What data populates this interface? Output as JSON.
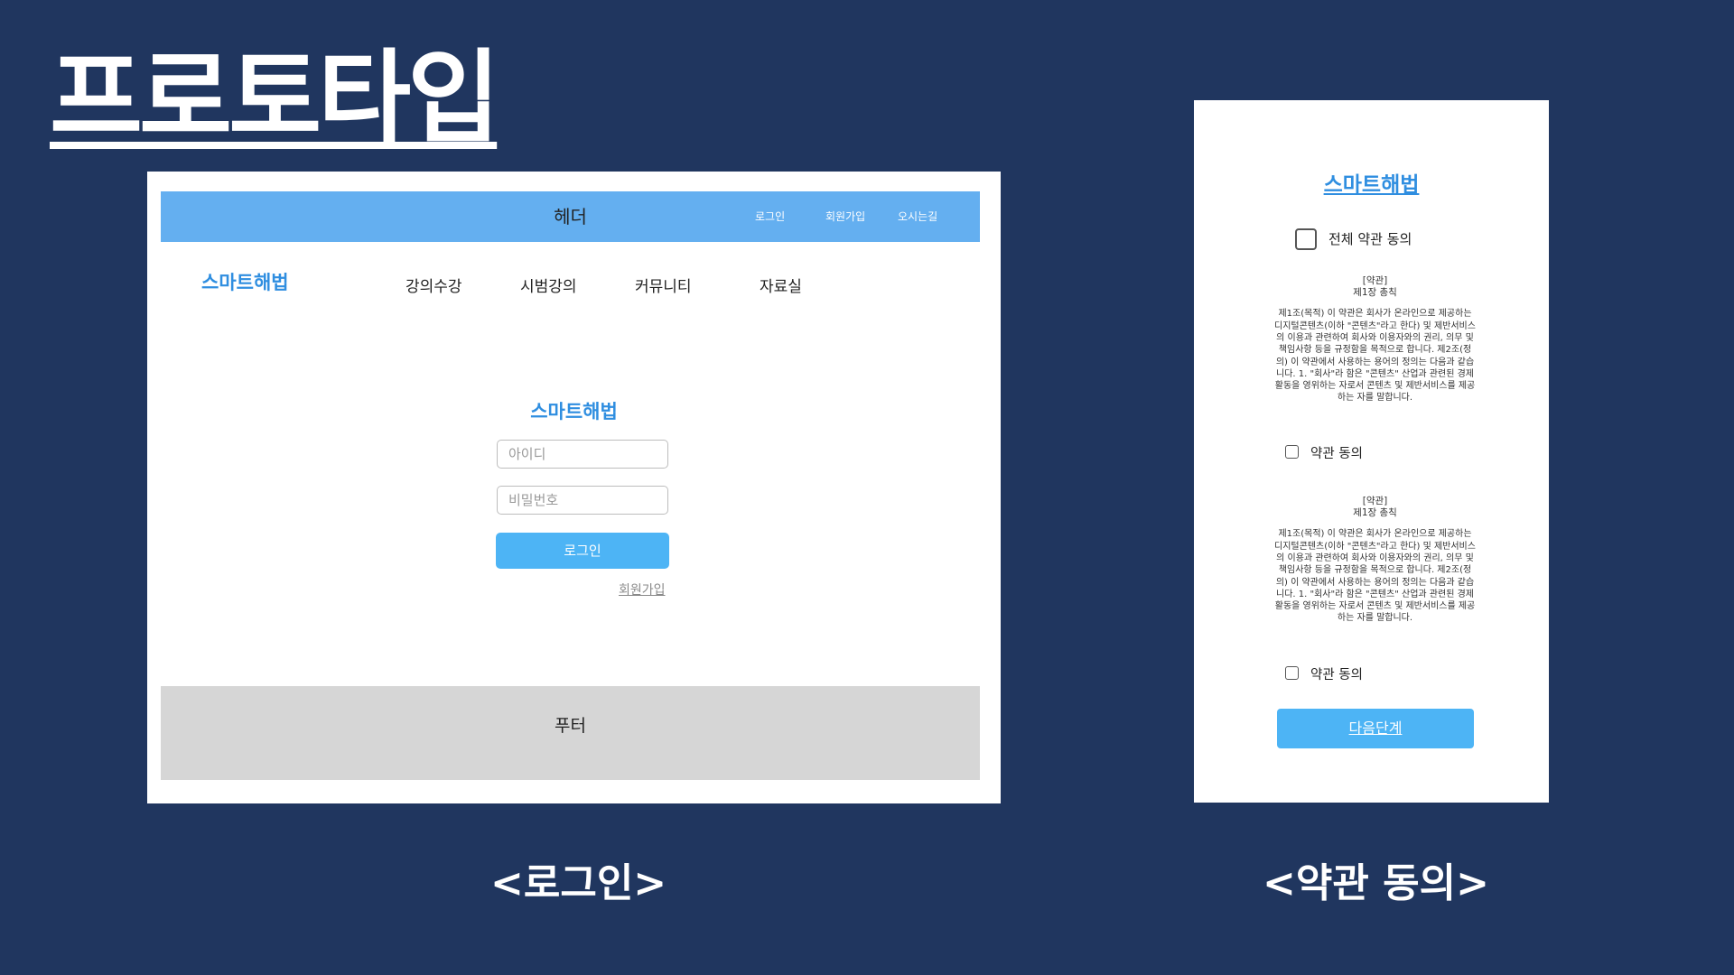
{
  "slide": {
    "title": "프로토타입",
    "captions": {
      "login": "<로그인>",
      "terms": "<약관 동의>"
    }
  },
  "login_page": {
    "header": {
      "title": "헤더",
      "links": [
        "로그인",
        "회원가입",
        "오시는길"
      ]
    },
    "logo": "스마트해법",
    "nav": [
      "강의수강",
      "시범강의",
      "커뮤니티",
      "자료실"
    ],
    "form": {
      "logo": "스마트해법",
      "id_placeholder": "아이디",
      "password_placeholder": "비밀번호",
      "login_button": "로그인",
      "signup_link": "회원가입"
    },
    "footer": "푸터"
  },
  "terms_page": {
    "logo": "스마트해법",
    "agree_all_label": "전체 약관 동의",
    "terms": [
      {
        "heading": "[약관]",
        "chapter": "제1장 총칙",
        "body": "제1조(목적) 이 약관은 회사가 온라인으로 제공하는 디지털콘텐츠(이하 \"콘텐츠\"라고 한다) 및 제반서비스의 이용과 관련하여 회사와 이용자와의 권리, 의무 및 책임사항 등을 규정함을 목적으로 합니다. 제2조(정의) 이 약관에서 사용하는 용어의 정의는 다음과 같습니다. 1. \"회사\"라 함은 \"콘텐츠\" 산업과 관련된 경제활동을 영위하는 자로서 콘텐츠 및 제반서비스를 제공하는 자를 말합니다.",
        "agree_label": "약관 동의"
      },
      {
        "heading": "[약관]",
        "chapter": "제1장 총칙",
        "body": "제1조(목적) 이 약관은 회사가 온라인으로 제공하는 디지털콘텐츠(이하 \"콘텐츠\"라고 한다) 및 제반서비스의 이용과 관련하여 회사와 이용자와의 권리, 의무 및 책임사항 등을 규정함을 목적으로 합니다. 제2조(정의) 이 약관에서 사용하는 용어의 정의는 다음과 같습니다. 1. \"회사\"라 함은 \"콘텐츠\" 산업과 관련된 경제활동을 영위하는 자로서 콘텐츠 및 제반서비스를 제공하는 자를 말합니다.",
        "agree_label": "약관 동의"
      }
    ],
    "next_button": "다음단계"
  },
  "colors": {
    "background": "#20365f",
    "header_bar": "#64aff0",
    "brand_blue": "#2f8ee0",
    "button_blue": "#4db4f5",
    "footer_gray": "#d6d6d6"
  }
}
